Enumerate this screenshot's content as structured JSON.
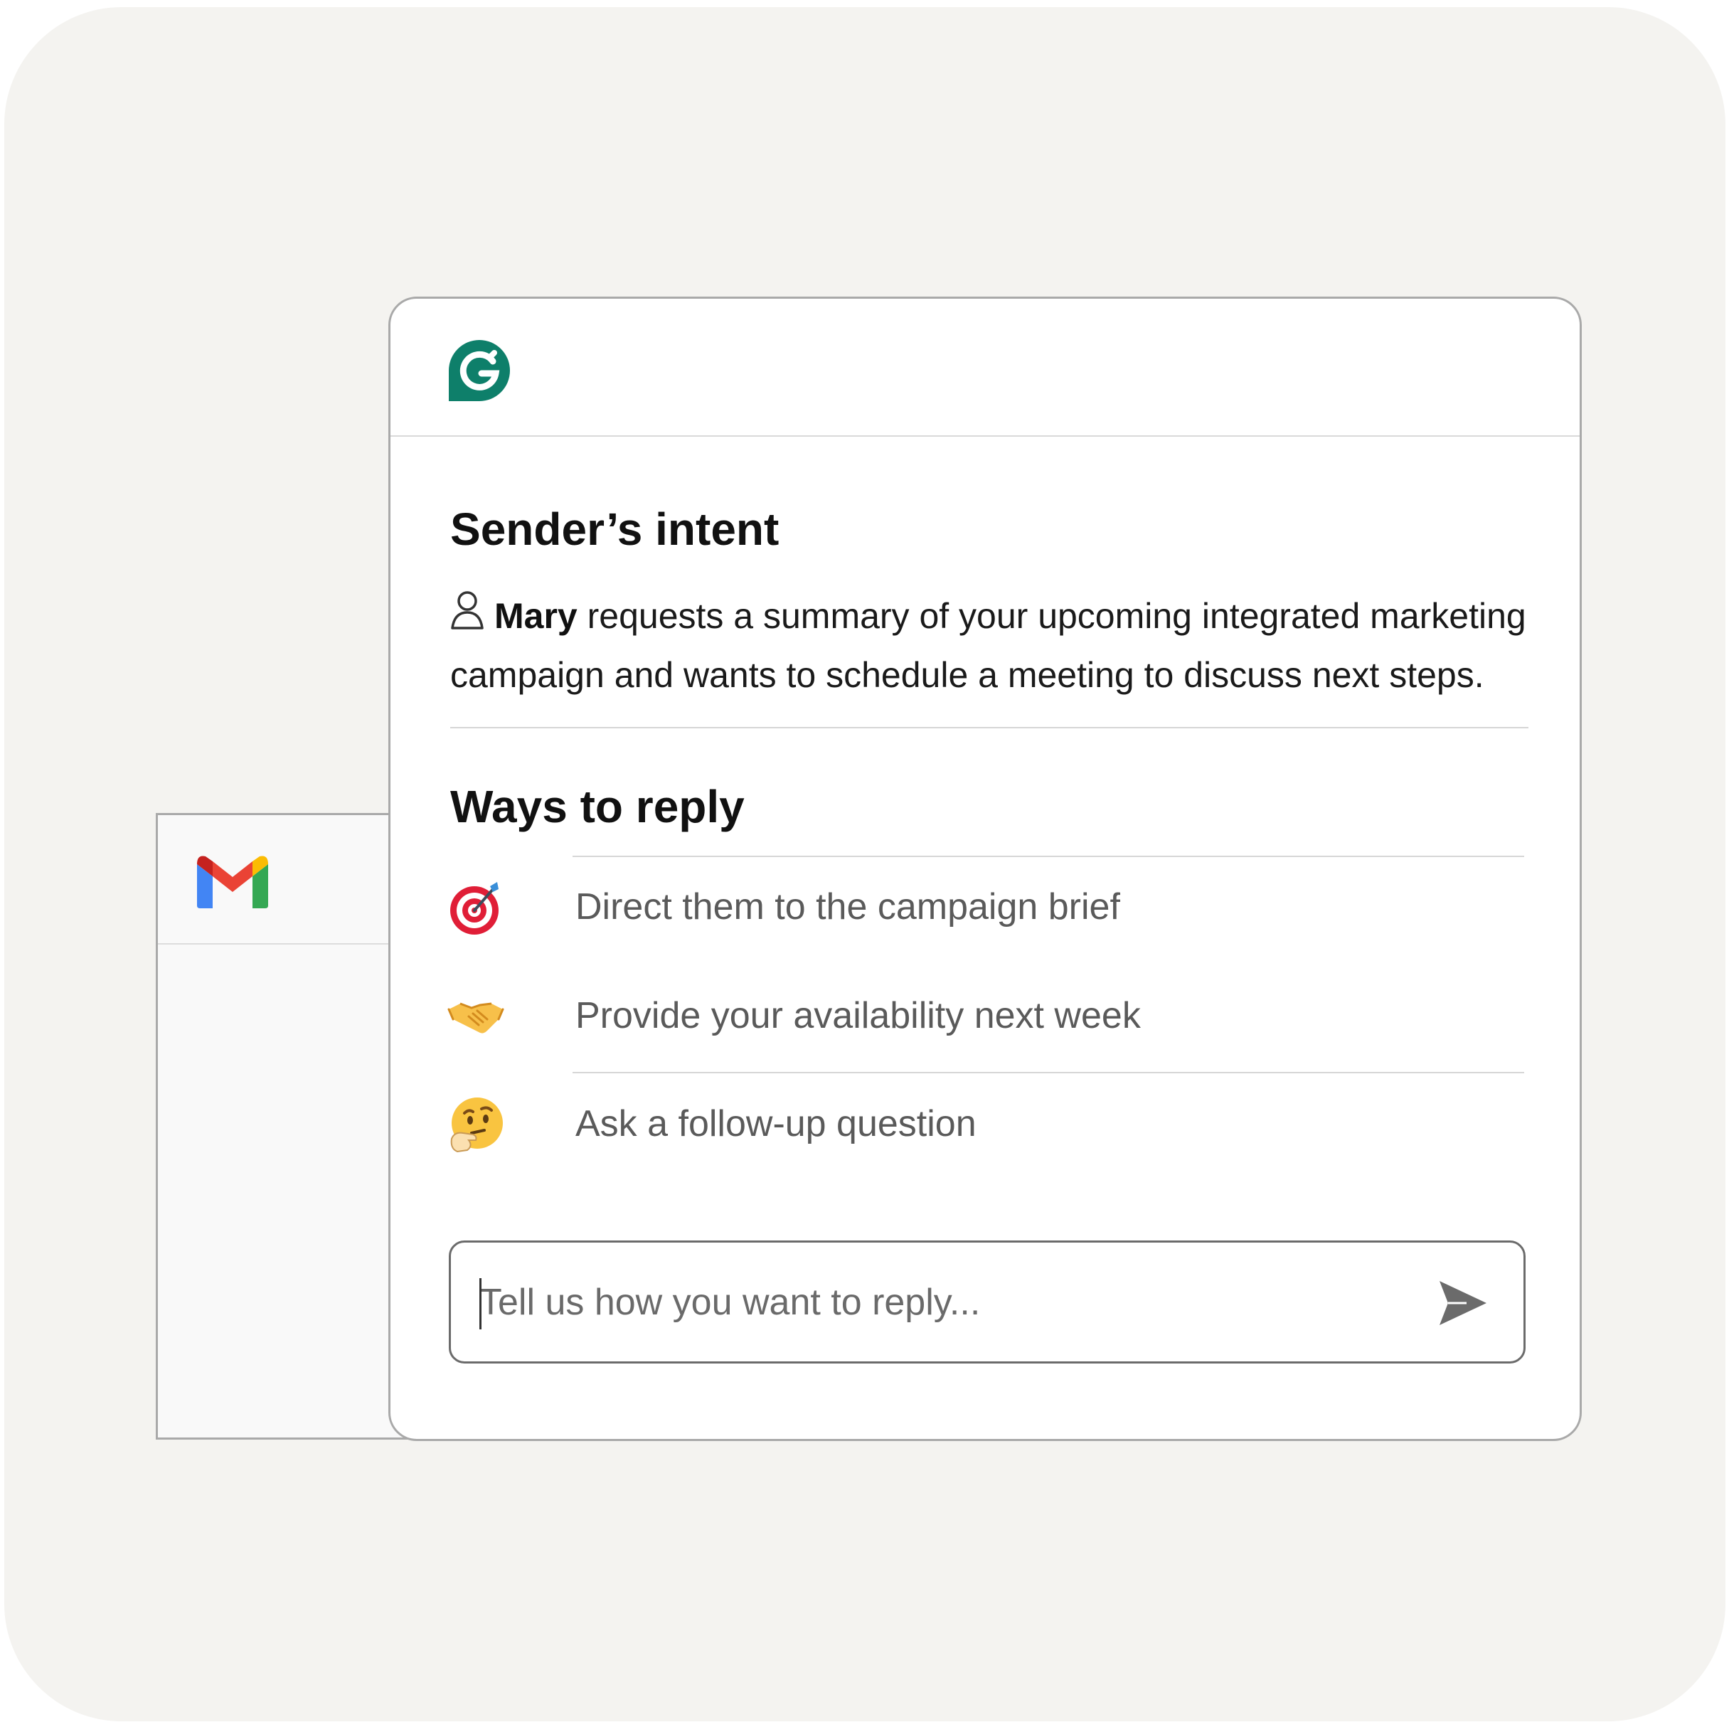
{
  "gmail": {
    "logo_icon": "gmail-logo-icon",
    "colors": {
      "red": "#EA4335",
      "blue": "#4285F4",
      "green": "#34A853",
      "yellow": "#FBBC04",
      "dark_red": "#C5221F"
    }
  },
  "grammarly": {
    "logo_icon": "grammarly-logo-icon",
    "brand_color": "#0E7F6A"
  },
  "intent": {
    "title": "Sender’s intent",
    "icon": "user-icon",
    "name": "Mary",
    "text": " requests a summary of your upcoming integrated marketing campaign and wants to schedule a meeting to discuss next steps."
  },
  "reply": {
    "title": "Ways to reply",
    "options": [
      {
        "icon": "target-icon",
        "label": "Direct them to the campaign brief"
      },
      {
        "icon": "handshake-icon",
        "label": "Provide your availability next week"
      },
      {
        "icon": "thinking-face-icon",
        "label": "Ask a follow-up question"
      }
    ],
    "input": {
      "placeholder": "Tell us how you want to reply...",
      "value": ""
    },
    "send_icon": "send-icon"
  }
}
